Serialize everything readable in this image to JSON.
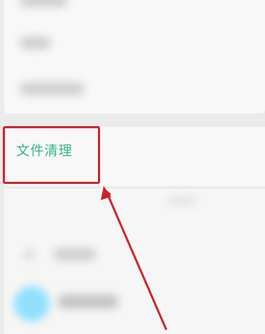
{
  "file_clean": {
    "label": "文件清理"
  },
  "colors": {
    "accent": "#2fb38a",
    "highlight": "#c8232c",
    "background": "#ebebeb"
  },
  "icons": [
    "annotation-arrow-icon"
  ]
}
